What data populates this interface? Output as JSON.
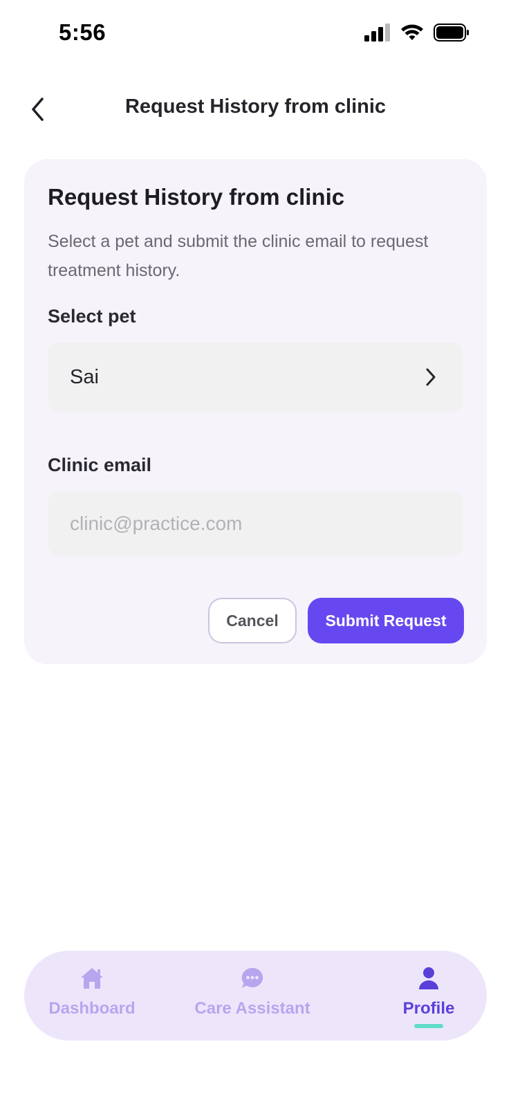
{
  "status_bar": {
    "time": "5:56",
    "icons": [
      "cellular-signal-icon",
      "wifi-icon",
      "battery-icon"
    ]
  },
  "header": {
    "back_icon": "chevron-left-icon",
    "title": "Request History from clinic"
  },
  "card": {
    "title": "Request History from clinic",
    "description": "Select a pet and submit the clinic email to request treatment history.",
    "pet_label": "Select pet",
    "pet_value": "Sai",
    "pet_chevron": "chevron-right-icon",
    "email_label": "Clinic email",
    "email_value": "",
    "email_placeholder": "clinic@practice.com",
    "cancel_label": "Cancel",
    "submit_label": "Submit Request"
  },
  "bottom_nav": {
    "items": [
      {
        "label": "Dashboard",
        "icon": "home-icon",
        "active": false
      },
      {
        "label": "Care Assistant",
        "icon": "chat-bubble-icon",
        "active": false
      },
      {
        "label": "Profile",
        "icon": "user-icon",
        "active": true
      }
    ]
  },
  "colors": {
    "accent": "#6748f0",
    "card_bg": "#f6f3fb",
    "nav_bg": "#ede6fb",
    "active_indicator": "#5fdcc9"
  }
}
